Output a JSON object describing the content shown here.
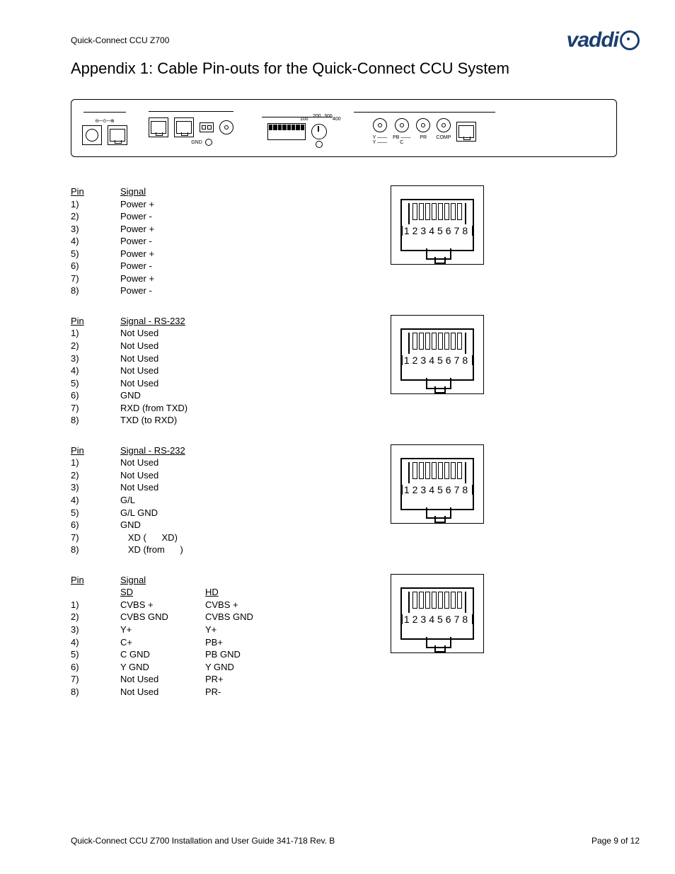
{
  "header": {
    "product": "Quick-Connect CCU Z700",
    "brand": "vaddi"
  },
  "title": "Appendix 1:  Cable Pin-outs for the Quick-Connect CCU System",
  "panel": {
    "gnd_label": "GND",
    "dial": {
      "n100": "100",
      "n200": "200",
      "n300": "300",
      "n400": "400"
    },
    "video_row1": {
      "y": "Y",
      "pb": "PB",
      "pr": "PR",
      "comp": "COMP"
    },
    "video_row2": {
      "y": "Y",
      "c": "C"
    }
  },
  "rj45_digits": "12345678",
  "tables": {
    "t1": {
      "pin_hd": "Pin",
      "sig_hd": "Signal",
      "rows": [
        {
          "pin": "1)",
          "sig": "Power +"
        },
        {
          "pin": "2)",
          "sig": "Power -"
        },
        {
          "pin": "3)",
          "sig": "Power +"
        },
        {
          "pin": "4)",
          "sig": "Power -"
        },
        {
          "pin": "5)",
          "sig": "Power +"
        },
        {
          "pin": "6)",
          "sig": "Power -"
        },
        {
          "pin": "7)",
          "sig": "Power +"
        },
        {
          "pin": "8)",
          "sig": "Power -"
        }
      ]
    },
    "t2": {
      "pin_hd": "Pin",
      "sig_hd": "Signal - RS-232",
      "rows": [
        {
          "pin": "1)",
          "sig": "Not Used"
        },
        {
          "pin": "2)",
          "sig": "Not Used"
        },
        {
          "pin": "3)",
          "sig": "Not Used"
        },
        {
          "pin": "4)",
          "sig": "Not Used"
        },
        {
          "pin": "5)",
          "sig": "Not Used"
        },
        {
          "pin": "6)",
          "sig": "GND"
        },
        {
          "pin": "7)",
          "sig": "RXD (from TXD)"
        },
        {
          "pin": "8)",
          "sig": "TXD (to RXD)"
        }
      ]
    },
    "t3": {
      "pin_hd": "Pin",
      "sig_hd": "Signal - RS-232",
      "rows": [
        {
          "pin": "1)",
          "sig": "Not Used"
        },
        {
          "pin": "2)",
          "sig": "Not Used"
        },
        {
          "pin": "3)",
          "sig": "Not Used"
        },
        {
          "pin": "4)",
          "sig": "G/L"
        },
        {
          "pin": "5)",
          "sig": "G/L GND"
        },
        {
          "pin": "6)",
          "sig": "GND"
        },
        {
          "pin": "7)",
          "sig": "   XD (      XD)"
        },
        {
          "pin": "8)",
          "sig": "   XD (from      )"
        }
      ]
    },
    "t4": {
      "pin_hd": "Pin",
      "sig_hd": "Signal",
      "sd_hd": "SD",
      "hd_hd": "HD",
      "rows": [
        {
          "pin": "1)",
          "sd": "CVBS +",
          "hd": "CVBS +"
        },
        {
          "pin": "2)",
          "sd": "CVBS GND",
          "hd": "CVBS  GND"
        },
        {
          "pin": "3)",
          "sd": "Y+",
          "hd": "Y+"
        },
        {
          "pin": "4)",
          "sd": "C+",
          "hd": "PB+"
        },
        {
          "pin": "5)",
          "sd": "C GND",
          "hd": "PB GND"
        },
        {
          "pin": "6)",
          "sd": "Y GND",
          "hd": "Y GND"
        },
        {
          "pin": "7)",
          "sd": "Not Used",
          "hd": "PR+"
        },
        {
          "pin": "8)",
          "sd": "Not Used",
          "hd": "PR-"
        }
      ]
    }
  },
  "footer": {
    "left": "Quick-Connect CCU Z700 Installation and User Guide 341-718 Rev. B",
    "right": "Page 9 of 12"
  }
}
